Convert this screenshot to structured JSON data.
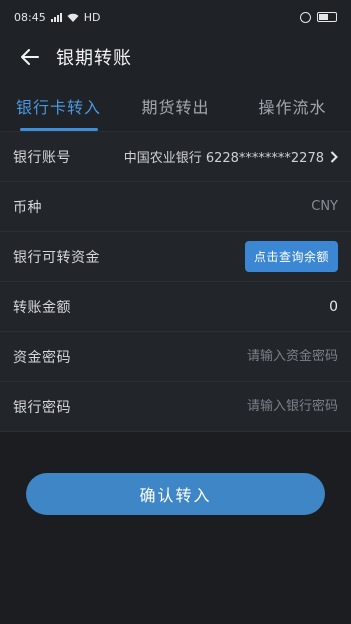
{
  "status_bar": {
    "time": "08:45",
    "network": "HD"
  },
  "header": {
    "title": "银期转账"
  },
  "tabs": [
    {
      "label": "银行卡转入",
      "active": true
    },
    {
      "label": "期货转出",
      "active": false
    },
    {
      "label": "操作流水",
      "active": false
    }
  ],
  "form": {
    "bank_account": {
      "label": "银行账号",
      "value": "中国农业银行 6228********2278"
    },
    "currency": {
      "label": "币种",
      "value": "CNY"
    },
    "available_funds": {
      "label": "银行可转资金",
      "button_label": "点击查询余额"
    },
    "amount": {
      "label": "转账金额",
      "value": "0"
    },
    "fund_password": {
      "label": "资金密码",
      "placeholder": "请输入资金密码"
    },
    "bank_password": {
      "label": "银行密码",
      "placeholder": "请输入银行密码"
    }
  },
  "confirm_label": "确认转入",
  "colors": {
    "accent": "#3d8fd8",
    "background": "#1b1d21",
    "button": "#3e86c6"
  }
}
